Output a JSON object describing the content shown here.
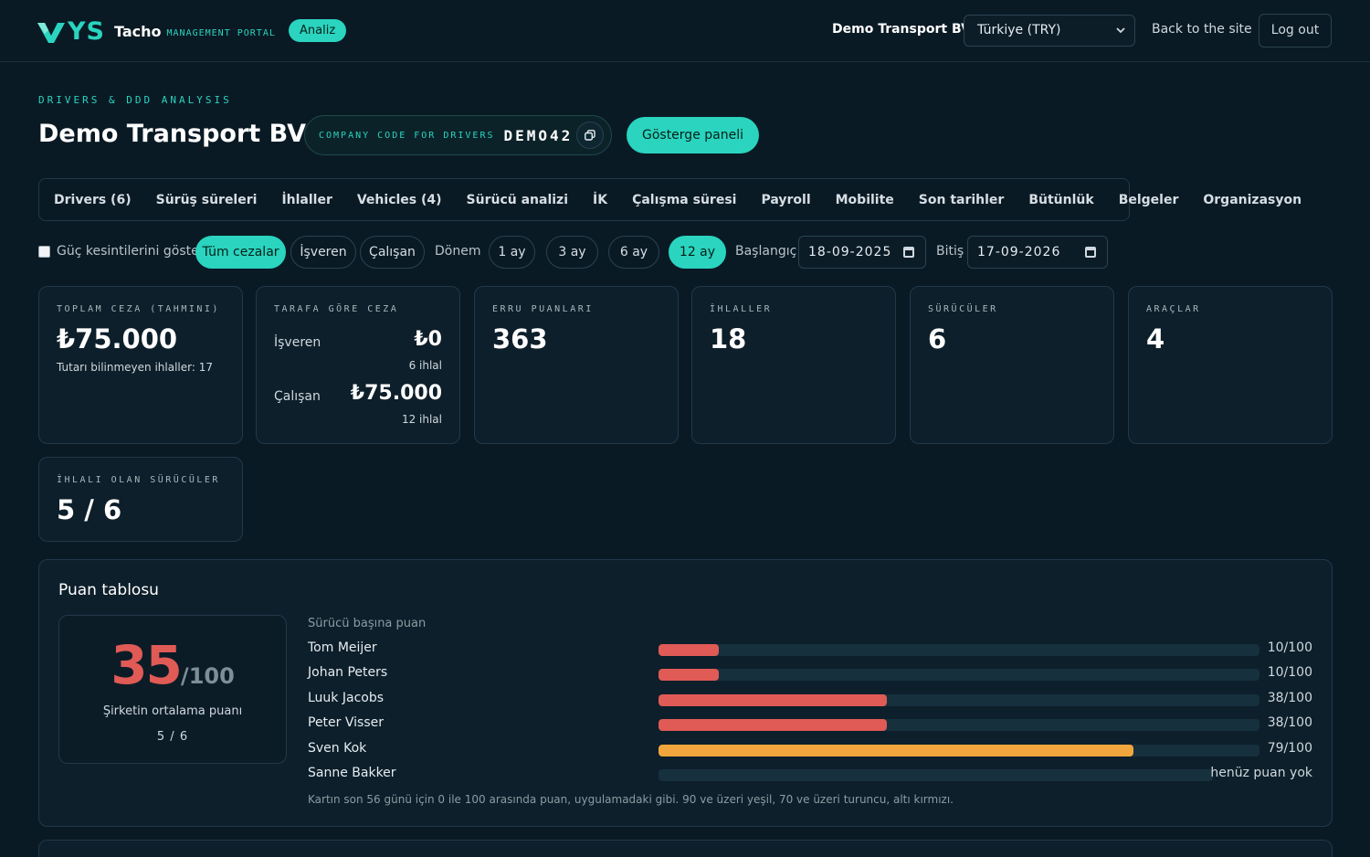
{
  "header": {
    "logo_ys": "YS",
    "logo_name": "Tacho",
    "logo_sub": "MANAGEMENT PORTAL",
    "badge": "Analiz",
    "company": "Demo Transport BV",
    "currency_select": "Türkiye (TRY)",
    "back_link": "Back to the site",
    "logout": "Log out"
  },
  "page": {
    "kicker": "DRIVERS & DDD ANALYSIS",
    "title": "Demo Transport BV",
    "code_label": "COMPANY CODE FOR DRIVERS",
    "code_value": "DEMO42",
    "dashboard_button": "Gösterge paneli"
  },
  "tabs": [
    "Drivers (6)",
    "Sürüş süreleri",
    "İhlaller",
    "Vehicles (4)",
    "Sürücü analizi",
    "İK",
    "Çalışma süresi",
    "Payroll",
    "Mobilite",
    "Son tarihler",
    "Bütünlük",
    "Belgeler",
    "Organizasyon"
  ],
  "filters": {
    "power_label": "Güç kesintilerini göster",
    "penalty_all": "Tüm cezalar",
    "penalty_employer": "İşveren",
    "penalty_employee": "Çalışan",
    "period_label": "Dönem",
    "period_1": "1 ay",
    "period_3": "3 ay",
    "period_6": "6 ay",
    "period_12": "12 ay",
    "start_label": "Başlangıç",
    "start_value": "18-09-2025",
    "end_label": "Bitiş",
    "end_value": "17-09-2026"
  },
  "stats": {
    "total_label": "TOPLAM CEZA (TAHMINI)",
    "total_value": "₺75.000",
    "total_note": "Tutarı bilinmeyen ihlaller: 17",
    "party_label": "TARAFA GÖRE CEZA",
    "employer_label": "İşveren",
    "employer_value": "₺0",
    "employer_count": "6 ihlal",
    "employee_label": "Çalışan",
    "employee_value": "₺75.000",
    "employee_count": "12 ihlal",
    "errors_label": "ERRU PUANLARI",
    "errors_value": "363",
    "violations_label": "İHLALLER",
    "violations_value": "18",
    "drivers_label": "SÜRÜCÜLER",
    "drivers_value": "6",
    "vehicles_label": "ARAÇLAR",
    "vehicles_value": "4",
    "violating_label": "İHLALI OLAN SÜRÜCÜLER",
    "violating_value": "5 / 6"
  },
  "scoreboard": {
    "title": "Puan tablosu",
    "avg_score": "35",
    "avg_max": "/100",
    "avg_caption": "Şirketin ortalama puanı",
    "avg_ratio": "5 / 6",
    "per_driver_title": "Sürücü başına puan",
    "drivers": [
      {
        "name": "Tom Meijer",
        "score": 10,
        "label": "10/100",
        "color": "#e05a56"
      },
      {
        "name": "Johan Peters",
        "score": 10,
        "label": "10/100",
        "color": "#e05a56"
      },
      {
        "name": "Luuk Jacobs",
        "score": 38,
        "label": "38/100",
        "color": "#e05a56"
      },
      {
        "name": "Peter Visser",
        "score": 38,
        "label": "38/100",
        "color": "#e05a56"
      },
      {
        "name": "Sven Kok",
        "score": 79,
        "label": "79/100",
        "color": "#f0a63c"
      },
      {
        "name": "Sanne Bakker",
        "score": null,
        "label": "henüz puan yok",
        "color": "#16303e"
      }
    ],
    "footnote": "Kartın son 56 günü için 0 ile 100 arasında puan, uygulamadaki gibi. 90 ve üzeri yeşil, 70 ve üzeri turuncu, altı kırmızı."
  },
  "colors": {
    "background": "#0a1a24",
    "accent": "#2ad4bf",
    "red": "#e05a56",
    "orange": "#f0a63c"
  }
}
